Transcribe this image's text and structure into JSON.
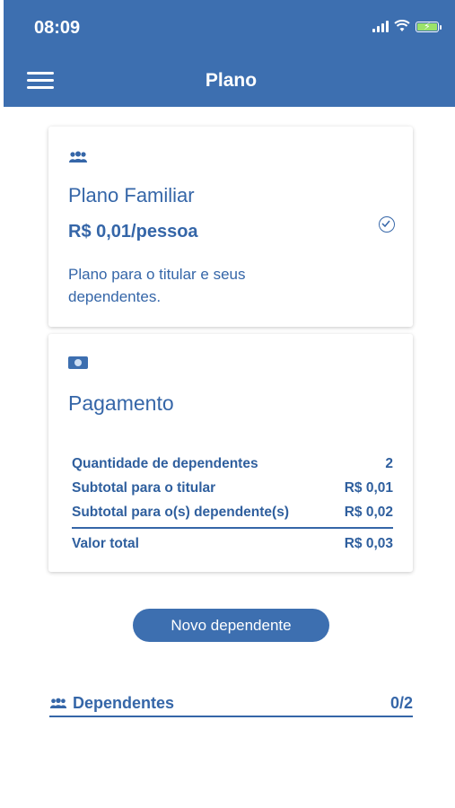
{
  "status_bar": {
    "time": "08:09"
  },
  "header": {
    "title": "Plano"
  },
  "plan_card": {
    "name": "Plano Familiar",
    "price": "R$ 0,01/pessoa",
    "description": "Plano para o titular e seus dependentes."
  },
  "payment_card": {
    "title": "Pagamento",
    "rows": [
      {
        "label": "Quantidade de dependentes",
        "value": "2"
      },
      {
        "label": "Subtotal para o titular",
        "value": "R$ 0,01"
      },
      {
        "label": "Subtotal para o(s) dependente(s)",
        "value": "R$ 0,02"
      }
    ],
    "total": {
      "label": "Valor total",
      "value": "R$ 0,03"
    }
  },
  "actions": {
    "new_dependent": "Novo dependente"
  },
  "dependents": {
    "label": "Dependentes",
    "count": "0/2"
  },
  "icons": {
    "menu": "hamburger-menu-icon",
    "plan": "people-icon",
    "selected": "check-circle-icon",
    "payment": "money-icon",
    "dependents": "people-icon"
  },
  "colors": {
    "primary": "#3d6fb0",
    "text": "#3566a8",
    "battery": "#9be26a"
  }
}
